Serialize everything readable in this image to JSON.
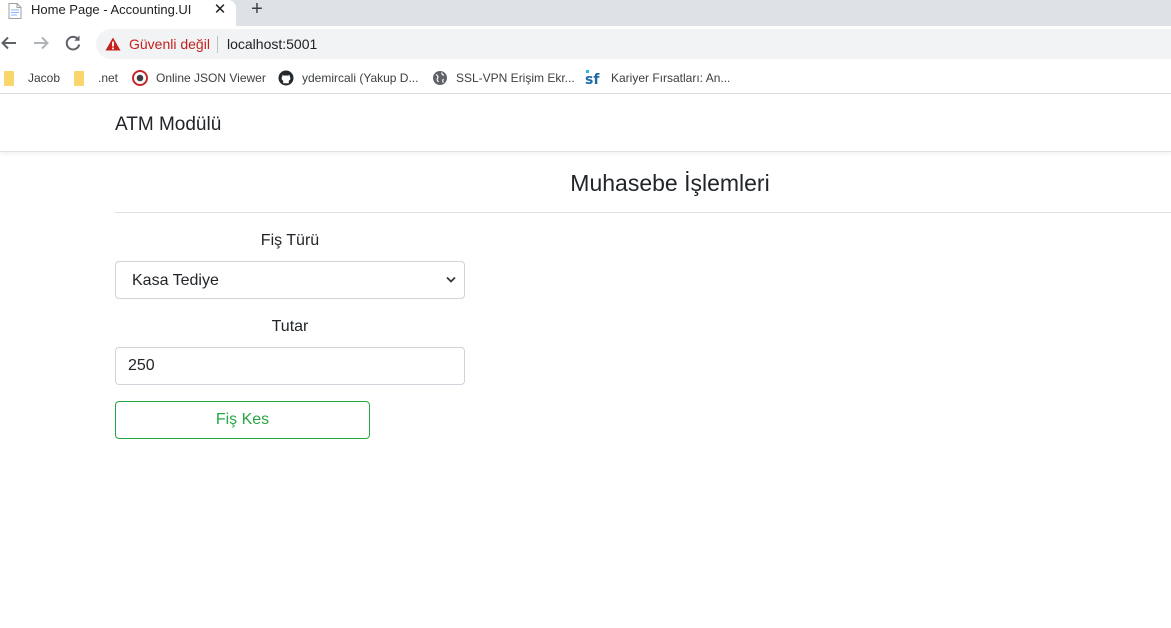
{
  "browser": {
    "tab": {
      "title": "Home Page - Accounting.UI",
      "close_glyph": "✕",
      "icon": "document-favicon"
    },
    "new_tab_glyph": "+",
    "toolbar": {
      "back_icon": "arrow-left-icon",
      "forward_icon": "arrow-right-icon",
      "reload_icon": "reload-icon"
    },
    "address_bar": {
      "security_label": "Güvenli değil",
      "url": "localhost:5001",
      "warning_color": "#c5221f"
    },
    "bookmarks": [
      {
        "label": "Jacob",
        "icon": "folder-icon"
      },
      {
        "label": ".net",
        "icon": "folder-icon"
      },
      {
        "label": "Online JSON Viewer",
        "icon": "json-viewer-icon"
      },
      {
        "label": "ydemircali (Yakup D...",
        "icon": "github-icon"
      },
      {
        "label": "SSL-VPN Erişim Ekr...",
        "icon": "globe-icon"
      },
      {
        "label": "Kariyer Fırsatları: An...",
        "icon": "sf-logo-icon"
      }
    ]
  },
  "page": {
    "navbar": {
      "brand": "ATM Modülü"
    },
    "heading": "Muhasebe İşlemleri",
    "form": {
      "voucher_type_label": "Fiş Türü",
      "voucher_type_selected": "Kasa Tediye",
      "amount_label": "Tutar",
      "amount_value": "250",
      "submit_label": "Fiş Kes",
      "accent_color": "#28a745"
    }
  }
}
